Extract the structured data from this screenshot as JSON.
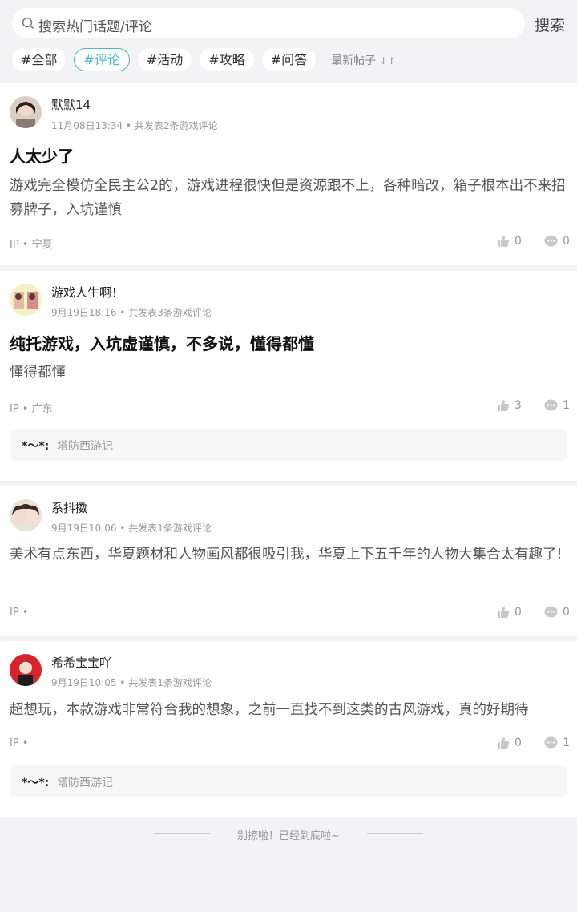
{
  "search": {
    "placeholder": "搜索热门话题/评论",
    "button": "搜索"
  },
  "tags": [
    "#全部",
    "#评论",
    "#活动",
    "#攻略",
    "#问答"
  ],
  "sort": {
    "label": "最新帖子",
    "icon": "⇃↾"
  },
  "posts": [
    {
      "user": "默默14",
      "meta": "11月08日13:34 • 共发表2条游戏评论",
      "title": "人太少了",
      "text": "游戏完全模仿全民主公2的，游戏进程很快但是资源跟不上，各种暗改，箱子根本出不来招募牌子，入坑谨慎",
      "ip": "IP • 宁夏",
      "likes": "0",
      "comments": "0"
    },
    {
      "user": "游戏人生啊！",
      "meta": "9月19日18:16 • 共发表3条游戏评论",
      "title": "纯托游戏，入坑虚谨慎，不多说，懂得都懂",
      "text": "懂得都懂",
      "ip": "IP • 广东",
      "likes": "3",
      "comments": "1",
      "quote": {
        "name": "*～*:",
        "game": "塔防西游记"
      }
    },
    {
      "user": "系抖擞",
      "meta": "9月19日10:06 • 共发表1条游戏评论",
      "text": "美术有点东西，华夏题材和人物画风都很吸引我，华夏上下五千年的人物大集合太有趣了!",
      "ip": "IP •",
      "likes": "0",
      "comments": "0"
    },
    {
      "user": "希希宝宝吖",
      "meta": "9月19日10:05 • 共发表1条游戏评论",
      "text": "超想玩，本款游戏非常符合我的想象，之前一直找不到这类的古风游戏，真的好期待",
      "ip": "IP •",
      "likes": "0",
      "comments": "1",
      "quote": {
        "name": "*～*:",
        "game": "塔防西游记"
      }
    }
  ],
  "footer": "别撩啦！已经到底啦~",
  "colors": {
    "accent": "#45b8c4",
    "background": "#f3f3f5"
  }
}
